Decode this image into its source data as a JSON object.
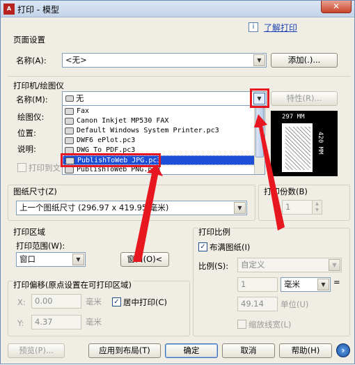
{
  "window": {
    "title": "打印 - 模型",
    "app_icon": "A",
    "close_glyph": "✕"
  },
  "help": {
    "icon": "i",
    "link": "了解打印"
  },
  "page_setup": {
    "label": "页面设置",
    "name_label": "名称(A):",
    "name_value": "<无>",
    "add_button": "添加(.)..."
  },
  "printer": {
    "label": "打印机/绘图仪",
    "name_label": "名称(M):",
    "name_value": "无",
    "properties_button": "特性(R)...",
    "plotter_label": "绘图仪:",
    "location_label": "位置:",
    "description_label": "说明:",
    "print_to_file_label": "打印到文",
    "dropdown_items": [
      "Fax",
      "Canon Inkjet MP530 FAX",
      "Default Windows System Printer.pc3",
      "DWF6 ePlot.pc3",
      "DWG To PDF.pc3",
      "PublishToWeb JPG.pc3",
      "PublishToWeb PNG.pc3"
    ],
    "selected_index": 5
  },
  "preview": {
    "width_label": "297 MM",
    "height_label": "420 MM"
  },
  "paper_size": {
    "label": "图纸尺寸(Z)",
    "value": "上一个图纸尺寸  (296.97 x 419.95 毫米)"
  },
  "copies": {
    "label": "打印份数(B)",
    "value": "1"
  },
  "plot_area": {
    "label": "打印区域",
    "range_label": "打印范围(W):",
    "range_value": "窗口",
    "window_button": "窗口(O)<"
  },
  "plot_scale": {
    "label": "打印比例",
    "fit_label": "布满图纸(I)",
    "fit_checked": "✓",
    "scale_label": "比例(S):",
    "scale_value": "自定义",
    "value1": "1",
    "unit_value": "毫米",
    "equals": "=",
    "value2": "49.14",
    "units_label": "单位(U)",
    "lineweight_label": "缩放线宽(L)"
  },
  "plot_offset": {
    "label": "打印偏移(原点设置在可打印区域)",
    "x_label": "X:",
    "x_value": "0.00",
    "x_unit": "毫米",
    "y_label": "Y:",
    "y_value": "4.37",
    "y_unit": "毫米",
    "center_label": "居中打印(C)",
    "center_checked": "✓"
  },
  "buttons": {
    "preview": "预览(P)...",
    "apply": "应用到布局(T)",
    "ok": "确定",
    "cancel": "取消",
    "help": "帮助(H)",
    "next": "›"
  },
  "colors": {
    "annotation_red": "#e8171f",
    "selection_blue": "#1c4fd6"
  }
}
